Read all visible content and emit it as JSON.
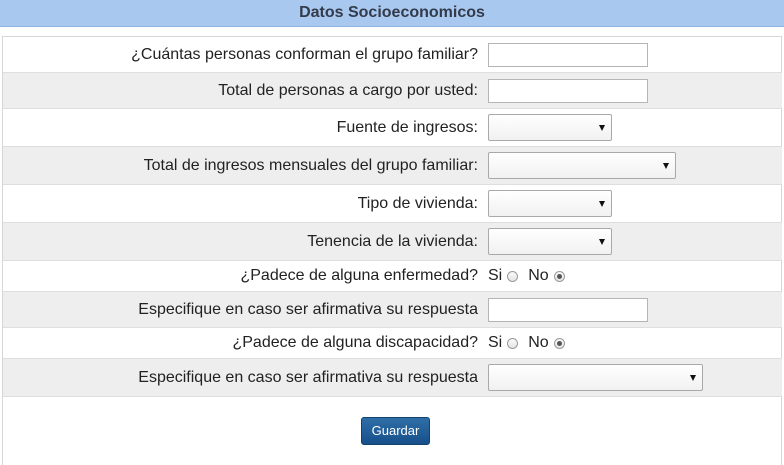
{
  "header": {
    "title": "Datos Socioeconomicos"
  },
  "form": {
    "q_grupo_familiar": {
      "label": "¿Cuántas personas conforman el grupo familiar?",
      "value": ""
    },
    "q_personas_cargo": {
      "label": "Total de personas a cargo por usted:",
      "value": ""
    },
    "q_fuente_ingresos": {
      "label": "Fuente de ingresos:",
      "selected": ""
    },
    "q_total_ingresos": {
      "label": "Total de ingresos mensuales del grupo familiar:",
      "selected": ""
    },
    "q_tipo_vivienda": {
      "label": "Tipo de vivienda:",
      "selected": ""
    },
    "q_tenencia_vivienda": {
      "label": "Tenencia de la vivienda:",
      "selected": ""
    },
    "q_enfermedad": {
      "label": "¿Padece de alguna enfermedad?",
      "option_si": "Si",
      "option_no": "No",
      "selected": "No"
    },
    "q_especifique_enfermedad": {
      "label": "Especifique en caso ser afirmativa su respuesta",
      "value": ""
    },
    "q_discapacidad": {
      "label": "¿Padece de alguna discapacidad?",
      "option_si": "Si",
      "option_no": "No",
      "selected": "No"
    },
    "q_especifique_discapacidad": {
      "label": "Especifique en caso ser afirmativa su respuesta",
      "selected": ""
    }
  },
  "actions": {
    "save_label": "Guardar"
  },
  "colors": {
    "header_bg": "#a9c8ef",
    "alt_row": "#eeeeee",
    "button": "#1f5f98"
  }
}
